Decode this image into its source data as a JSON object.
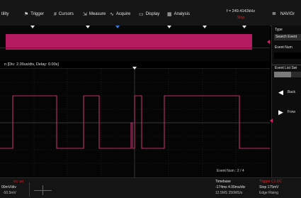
{
  "menu": {
    "items": [
      {
        "label": "tility",
        "icon": "none"
      },
      {
        "label": "Trigger",
        "icon": "flag-icon"
      },
      {
        "label": "Cursors",
        "icon": "cursors-icon"
      },
      {
        "label": "Measure",
        "icon": "measure-icon"
      },
      {
        "label": "Acquire",
        "icon": "acquire-icon"
      },
      {
        "label": "Display",
        "icon": "display-icon"
      },
      {
        "label": "Analysis",
        "icon": "analysis-icon"
      }
    ],
    "frequency": "f = 249.4142kHz",
    "run_state": "Stop",
    "nav_label": "NAV/Gr"
  },
  "zoom": {
    "label": "n [Div: 2.00us/div, Delay: 0.00s]",
    "event_num": "Event Num : 2 / 4"
  },
  "panel": {
    "type_label": "Type",
    "type_value": "Search Event",
    "event_num_label": "Event Num",
    "event_list_label": "Event List Swi",
    "back_label": "Back",
    "forward_label": "Forw"
  },
  "bottom": {
    "channel": "DC 1M",
    "scale": "00mV/div",
    "offset": "-50.5mV",
    "timebase_title": "Timebase",
    "timebase_line1": "-174ms  4.00ms/div",
    "timebase_line2": "12.5MS    250MS/s",
    "trigger_title": "Trigger      C1 DC",
    "trigger_line1": "Stop        175mV",
    "trigger_line2": "Edge        Rising"
  },
  "colors": {
    "trace": "#d0206e",
    "accent_red": "#e0202a",
    "marker_blue": "#3b7ad8"
  }
}
